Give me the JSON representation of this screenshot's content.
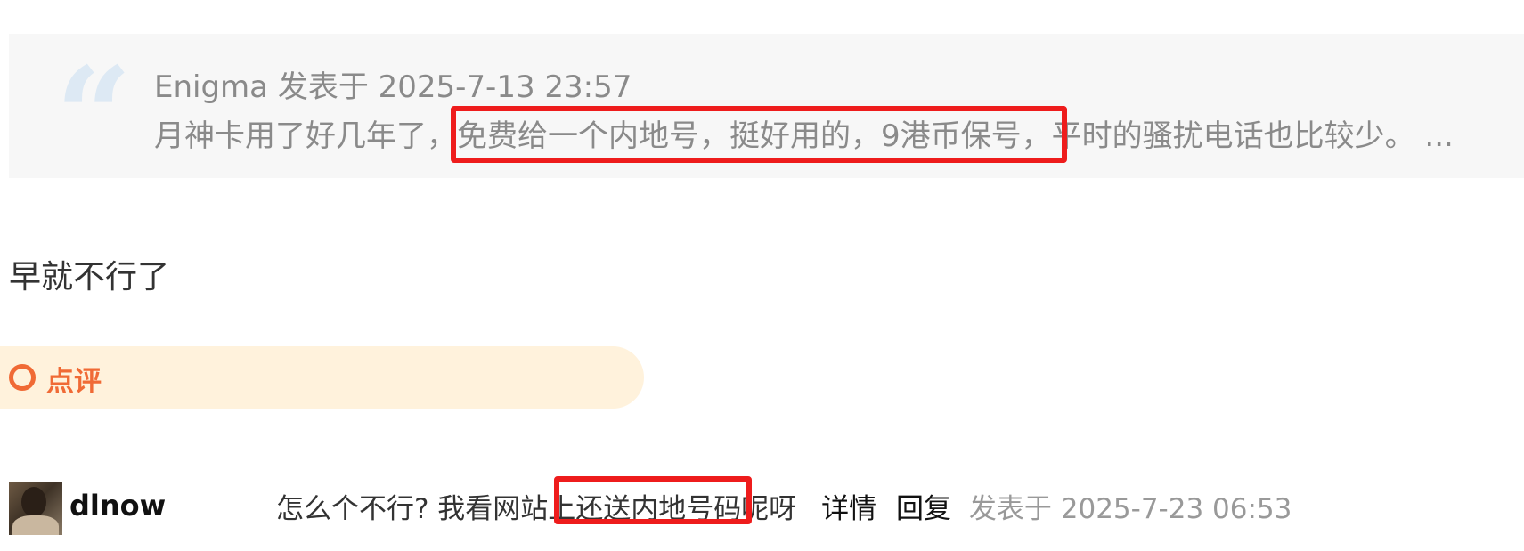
{
  "quote": {
    "mark": "“",
    "meta": "Enigma 发表于 2025-7-13 23:57",
    "text": "月神卡用了好几年了，免费给一个内地号，挺好用的，9港币保号，平时的骚扰电话也比较少。 ..."
  },
  "reply": {
    "text": "早就不行了"
  },
  "rating": {
    "icon": "circle-icon",
    "label": "点评"
  },
  "comment": {
    "avatar": "user-avatar",
    "username": "dlnow",
    "text": "怎么个不行? 我看网站上还送内地号码呢呀",
    "detail_link": "详情",
    "reply_link": "回复",
    "time": "发表于 2025-7-23 06:53"
  },
  "colors": {
    "highlight": "#ee1c1c",
    "rating_accent": "#f06a35",
    "rating_bg": "#fff2dc",
    "quote_bg": "#f7f7f7"
  }
}
